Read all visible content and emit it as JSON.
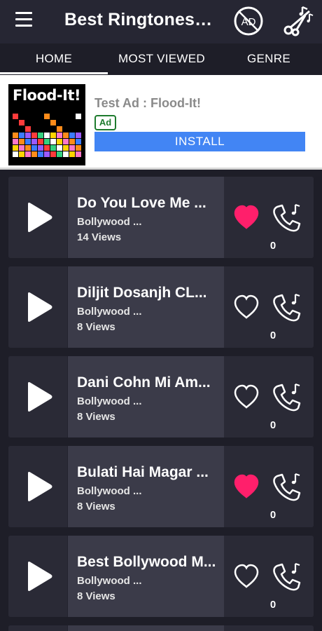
{
  "appbar": {
    "title": "Best Ringtones f...",
    "menu_icon": "hamburger-menu-icon",
    "noad_icon": "no-ads-icon",
    "noad_label": "AD",
    "cutter_icon": "scissors-music-icon"
  },
  "tabs": [
    {
      "label": "HOME",
      "active": true
    },
    {
      "label": "MOST VIEWED",
      "active": false
    },
    {
      "label": "GENRE",
      "active": false
    }
  ],
  "ad": {
    "image_text": "Flood-It!",
    "headline": "Test Ad : Flood-It!",
    "badge": "Ad",
    "cta": "INSTALL",
    "cta_color": "#4285f4"
  },
  "songs": [
    {
      "title": "Do You Love Me  ...",
      "category": "Bollywood ...",
      "views": "14 Views",
      "liked": true,
      "count": "0"
    },
    {
      "title": "Diljit Dosanjh  CL...",
      "category": "Bollywood ...",
      "views": "8 Views",
      "liked": false,
      "count": "0"
    },
    {
      "title": "Dani Cohn  Mi Am...",
      "category": "Bollywood ...",
      "views": "8 Views",
      "liked": false,
      "count": "0"
    },
    {
      "title": "Bulati Hai Magar ...",
      "category": "Bollywood ...",
      "views": "8 Views",
      "liked": true,
      "count": "0"
    },
    {
      "title": "Best Bollywood M...",
      "category": "Bollywood ...",
      "views": "8 Views",
      "liked": false,
      "count": "0"
    }
  ],
  "colors": {
    "background": "#1e1e28",
    "card": "#2a2a36",
    "card_info": "#3b3b49",
    "liked_heart": "#ff1f6b",
    "ad_badge": "#1e7b2e"
  }
}
